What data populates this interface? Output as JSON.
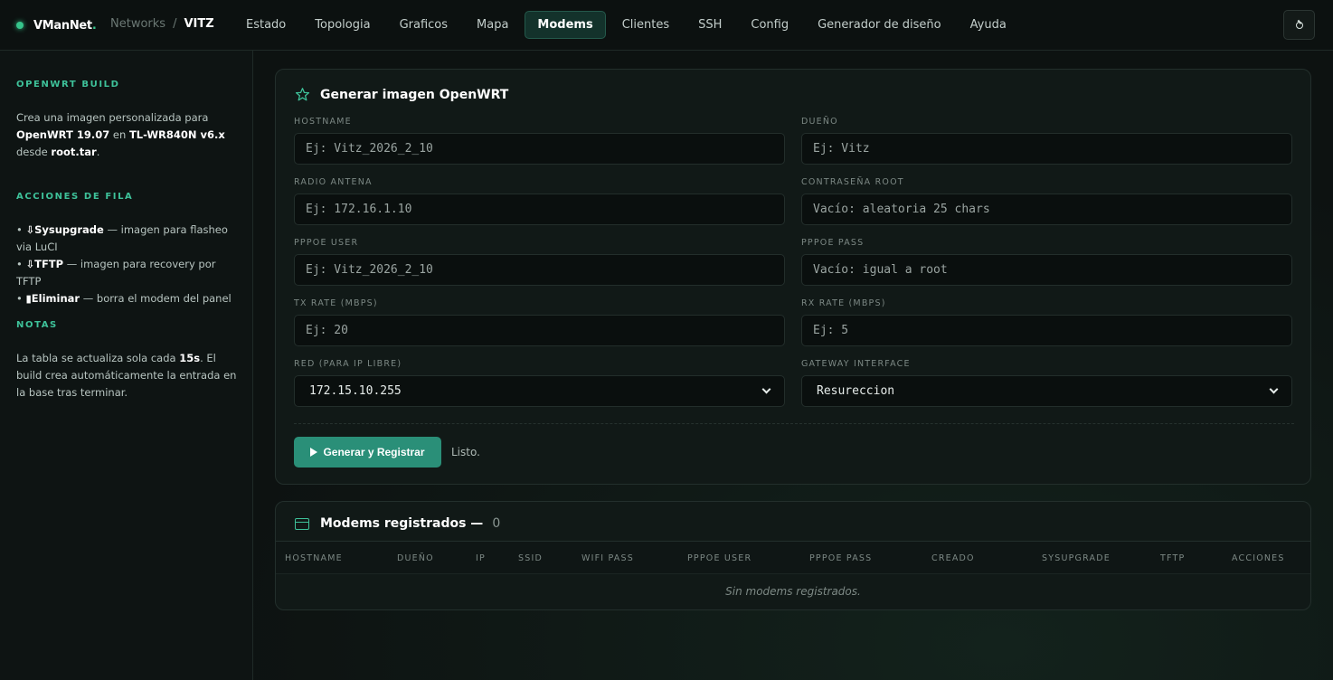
{
  "brand": {
    "name": "VManNet",
    "dot": "."
  },
  "breadcrumb": {
    "root": "Networks",
    "separator": "/",
    "current": "VITZ"
  },
  "nav": [
    "Estado",
    "Topologia",
    "Graficos",
    "Mapa",
    "Modems",
    "Clientes",
    "SSH",
    "Config",
    "Generador de diseño",
    "Ayuda"
  ],
  "nav_active": "Modems",
  "sidebar": {
    "build_heading": "OPENWRT BUILD",
    "build_text": {
      "pre": "Crea una imagen personalizada para ",
      "os": "OpenWRT 19.07",
      "mid": " en ",
      "device": "TL-WR840N v6.x",
      "post1": " desde ",
      "file": "root.tar",
      "post2": "."
    },
    "actions_heading": "ACCIONES DE FILA",
    "actions": [
      {
        "bullet": "• ",
        "icon": "⇩",
        "name": "Sysupgrade",
        "desc": " — imagen para flasheo via LuCI"
      },
      {
        "bullet": "• ",
        "icon": "⇩",
        "name": "TFTP",
        "desc": " — imagen para recovery por TFTP"
      },
      {
        "bullet": "• ",
        "icon": "▮",
        "name": "Eliminar",
        "desc": " — borra el modem del panel"
      }
    ],
    "notes_heading": "NOTAS",
    "notes_text": {
      "pre": "La tabla se actualiza sola cada ",
      "interval": "15s",
      "post": ". El build crea automáticamente la entrada en la base tras terminar."
    }
  },
  "generator": {
    "title": "Generar imagen OpenWRT",
    "fields": {
      "hostname": {
        "label": "HOSTNAME",
        "placeholder": "Ej: Vitz_2026_2_10"
      },
      "owner": {
        "label": "DUEÑO",
        "placeholder": "Ej: Vitz"
      },
      "radio": {
        "label": "RADIO ANTENA",
        "placeholder": "Ej: 172.16.1.10"
      },
      "root_pass": {
        "label": "CONTRASEÑA ROOT",
        "placeholder": "Vacío: aleatoria 25 chars"
      },
      "pppoe_user": {
        "label": "PPPOE USER",
        "placeholder": "Ej: Vitz_2026_2_10"
      },
      "pppoe_pass": {
        "label": "PPPOE PASS",
        "placeholder": "Vacío: igual a root"
      },
      "tx_rate": {
        "label": "TX RATE (MBPS)",
        "placeholder": "Ej: 20"
      },
      "rx_rate": {
        "label": "RX RATE (MBPS)",
        "placeholder": "Ej: 5"
      },
      "network": {
        "label": "RED (PARA IP LIBRE)",
        "value": "172.15.10.255"
      },
      "gateway": {
        "label": "GATEWAY INTERFACE",
        "value": "Resureccion"
      }
    },
    "submit_label": "Generar y Registrar",
    "status": "Listo."
  },
  "modems": {
    "title": "Modems registrados —",
    "count": "0",
    "columns": [
      "HOSTNAME",
      "DUEÑO",
      "IP",
      "SSID",
      "WIFI PASS",
      "PPPOE USER",
      "PPPOE PASS",
      "CREADO",
      "SYSUPGRADE",
      "TFTP",
      "ACCIONES"
    ],
    "empty_message": "Sin modems registrados."
  },
  "colors": {
    "accent": "#3ec29a",
    "button": "#2a8f78",
    "background": "#0d1211"
  }
}
